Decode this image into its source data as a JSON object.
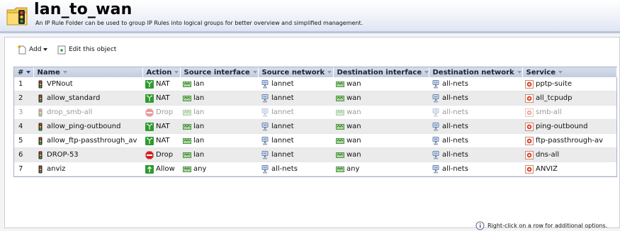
{
  "header": {
    "title": "lan_to_wan",
    "subtitle": "An IP Rule Folder can be used to group IP Rules into logical groups for better overview and simplified management."
  },
  "toolbar": {
    "add_label": "Add",
    "edit_label": "Edit this object"
  },
  "columns": [
    "#",
    "Name",
    "Action",
    "Source interface",
    "Source network",
    "Destination interface",
    "Destination network",
    "Service"
  ],
  "rows": [
    {
      "num": "1",
      "name": "VPNout",
      "action": "NAT",
      "src_if": "lan",
      "src_net": "lannet",
      "dst_if": "wan",
      "dst_net": "all-nets",
      "service": "pptp-suite",
      "disabled": false
    },
    {
      "num": "2",
      "name": "allow_standard",
      "action": "NAT",
      "src_if": "lan",
      "src_net": "lannet",
      "dst_if": "wan",
      "dst_net": "all-nets",
      "service": "all_tcpudp",
      "disabled": false
    },
    {
      "num": "3",
      "name": "drop_smb-all",
      "action": "Drop",
      "src_if": "lan",
      "src_net": "lannet",
      "dst_if": "wan",
      "dst_net": "all-nets",
      "service": "smb-all",
      "disabled": true
    },
    {
      "num": "4",
      "name": "allow_ping-outbound",
      "action": "NAT",
      "src_if": "lan",
      "src_net": "lannet",
      "dst_if": "wan",
      "dst_net": "all-nets",
      "service": "ping-outbound",
      "disabled": false
    },
    {
      "num": "5",
      "name": "allow_ftp-passthrough_av",
      "action": "NAT",
      "src_if": "lan",
      "src_net": "lannet",
      "dst_if": "wan",
      "dst_net": "all-nets",
      "service": "ftp-passthrough-av",
      "disabled": false
    },
    {
      "num": "6",
      "name": "DROP-53",
      "action": "Drop",
      "src_if": "lan",
      "src_net": "lannet",
      "dst_if": "wan",
      "dst_net": "all-nets",
      "service": "dns-all",
      "disabled": false
    },
    {
      "num": "7",
      "name": "anviz",
      "action": "Allow",
      "src_if": "any",
      "src_net": "all-nets",
      "dst_if": "any",
      "dst_net": "all-nets",
      "service": "ANVIZ",
      "disabled": false
    }
  ],
  "hint": "Right-click on a row for additional options.",
  "colors": {
    "header_bg": "#dfe5f2",
    "grid_header": "#c3cde0",
    "nat_green": "#2f9a2f",
    "drop_red": "#d42020"
  }
}
